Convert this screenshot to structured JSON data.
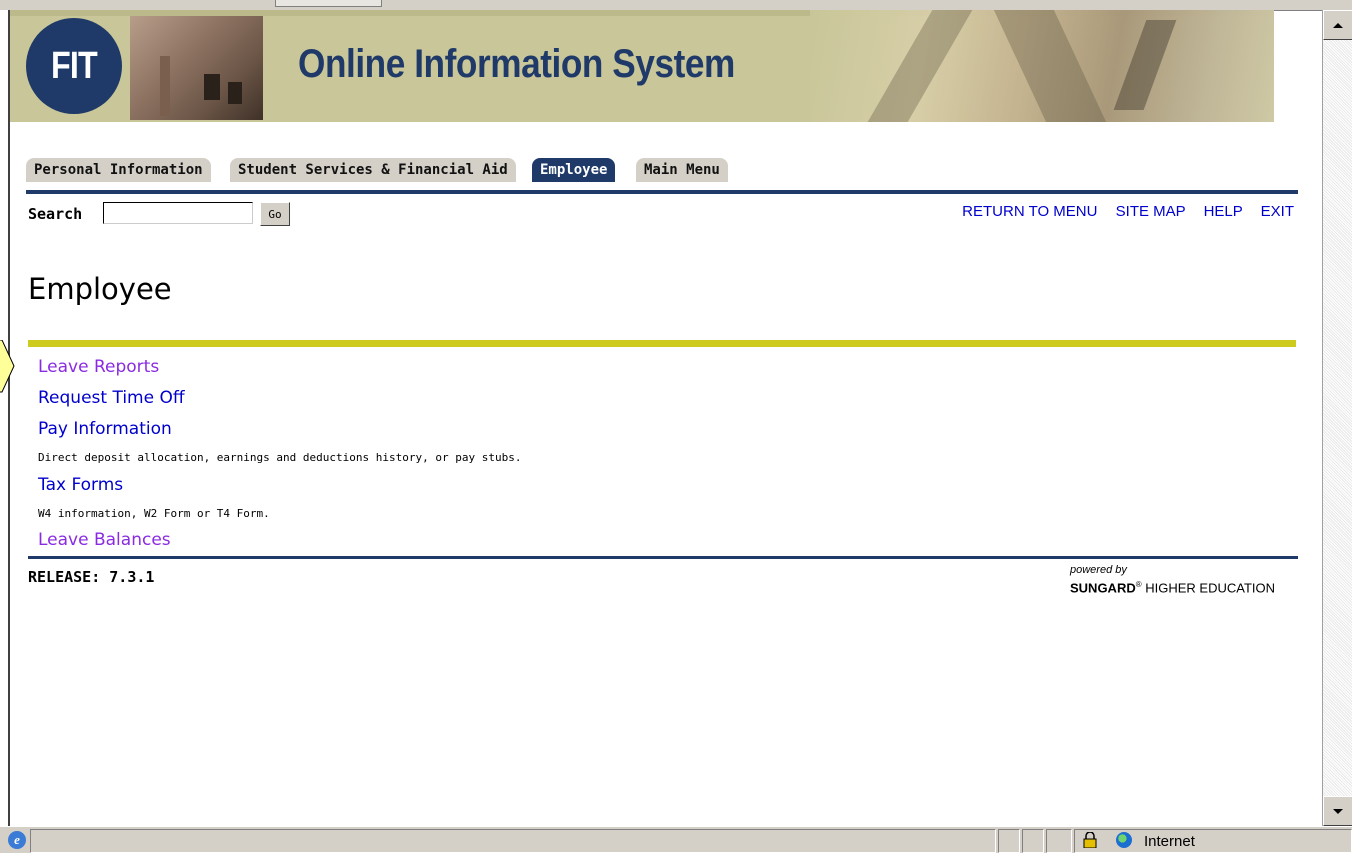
{
  "banner": {
    "logo_text": "FIT",
    "title": "Online Information System"
  },
  "tabs": [
    {
      "label": "Personal Information",
      "active": false
    },
    {
      "label": "Student Services & Financial Aid",
      "active": false
    },
    {
      "label": "Employee",
      "active": true
    },
    {
      "label": "Main Menu",
      "active": false
    }
  ],
  "search": {
    "label": "Search",
    "value": "",
    "go_label": "Go"
  },
  "top_links": [
    "RETURN TO MENU",
    "SITE MAP",
    "HELP",
    "EXIT"
  ],
  "page_title": "Employee",
  "menu_items": [
    {
      "label": "Leave Reports",
      "visited": true,
      "description": ""
    },
    {
      "label": "Request Time Off",
      "visited": false,
      "description": ""
    },
    {
      "label": "Pay Information",
      "visited": false,
      "description": "Direct deposit allocation, earnings and deductions history, or pay stubs."
    },
    {
      "label": "Tax Forms",
      "visited": false,
      "description": "W4 information, W2 Form or T4 Form."
    },
    {
      "label": "Leave Balances",
      "visited": true,
      "description": ""
    }
  ],
  "footer": {
    "release": "RELEASE: 7.3.1",
    "powered_by": "powered by",
    "brand_bold": "SUNGARD",
    "brand_rest": "HIGHER EDUCATION",
    "brand_mark": "®"
  },
  "statusbar": {
    "zone": "Internet"
  },
  "colors": {
    "navy": "#1f3a68",
    "olive_bar": "#cdcc1e",
    "link": "#0000cc",
    "visited_link": "#8a2be2",
    "banner_bg": "#c9c79a"
  },
  "icons": {
    "browser": "ie-icon",
    "lock": "lock-icon",
    "zone": "globe-icon"
  }
}
